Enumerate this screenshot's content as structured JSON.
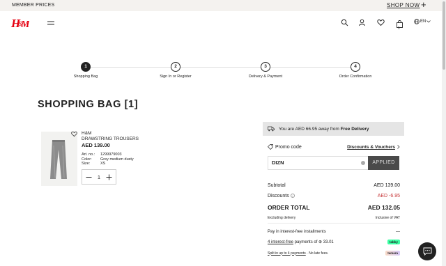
{
  "topbar": {
    "member_prices": "MEMBER PRICES",
    "shop_now": "SHOP NOW",
    "plus": "+"
  },
  "header": {
    "lang": "EN",
    "cart_count": "1",
    "brand_color": "#e50010"
  },
  "steps": [
    {
      "num": "1",
      "label": "Shopping Bag"
    },
    {
      "num": "2",
      "label": "Sign In or Register"
    },
    {
      "num": "3",
      "label": "Delivery & Payment"
    },
    {
      "num": "4",
      "label": "Order Confirmation"
    }
  ],
  "page_title": "SHOPPING BAG [1]",
  "product": {
    "brand": "H&M",
    "name": "DRAWSTRING TROUSERS",
    "price": "AED 139.00",
    "art_label": "Art. no.:",
    "art_value": "1299979003",
    "color_label": "Color:",
    "color_value": "Grey medium dusty",
    "size_label": "Size:",
    "size_value": "XS",
    "quantity": "1"
  },
  "summary": {
    "delivery_prefix": "You are AED 66.95 away from",
    "delivery_bold": "Free Delivery",
    "promo_label": "Promo code",
    "discounts_link": "Discounts & Vouchers",
    "promo_value": "DIZN",
    "applied_label": "APPLIED",
    "subtotal_label": "Subtotal",
    "subtotal_value": "AED 139.00",
    "discounts_label": "Discounts",
    "discounts_value": "AED -6.95",
    "order_total_label": "ORDER TOTAL",
    "order_total_value": "AED 132.05",
    "excluding_delivery": "Excluding delivery",
    "inclusive_vat": "Inclusive of VAT",
    "pay_installments": "Pay in interest-free installments",
    "pay_toggle": "—",
    "tabby_link": "4 interest-free",
    "tabby_text": "payments of ⊕ 33.01",
    "tabby_badge": "tabby",
    "tamara_link": "Split in up to 4 payments",
    "tamara_text": "· No late fees.",
    "tamara_badge": "tamara"
  }
}
